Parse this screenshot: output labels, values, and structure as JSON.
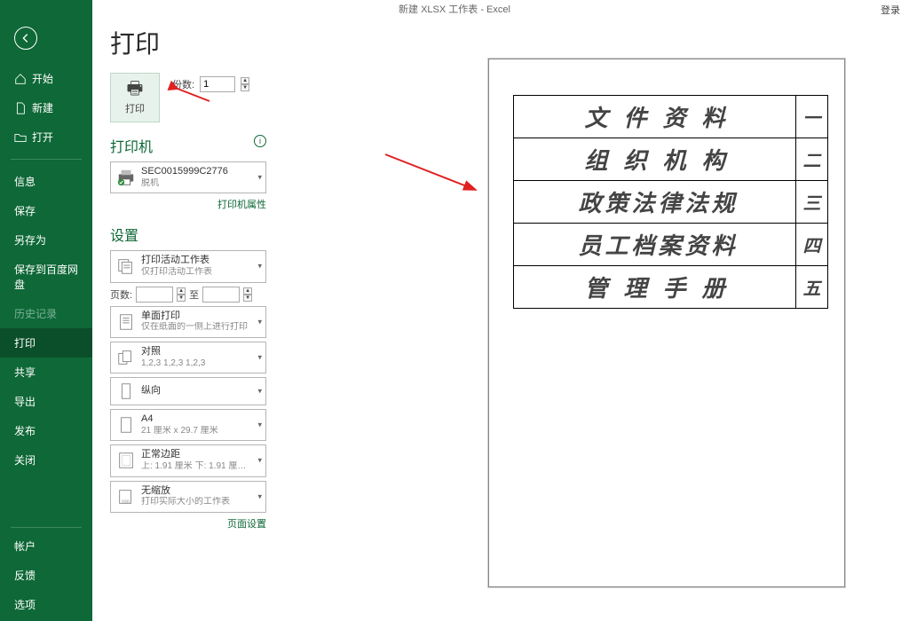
{
  "window": {
    "title": "新建 XLSX 工作表 - Excel",
    "login": "登录"
  },
  "sidebar": {
    "home": "开始",
    "new": "新建",
    "open": "打开",
    "info": "信息",
    "save": "保存",
    "saveas": "另存为",
    "savebaidu": "保存到百度网盘",
    "history": "历史记录",
    "print": "打印",
    "share": "共享",
    "export": "导出",
    "publish": "发布",
    "close": "关闭",
    "account": "帐户",
    "feedback": "反馈",
    "options": "选项"
  },
  "panel": {
    "title": "打印",
    "print_btn": "打印",
    "copies_label": "份数:",
    "copies_value": "1",
    "printer_section": "打印机",
    "printer_name": "SEC0015999C2776",
    "printer_status": "脱机",
    "printer_props": "打印机属性",
    "settings_section": "设置",
    "scope_main": "打印活动工作表",
    "scope_sub": "仅打印活动工作表",
    "pages_label": "页数:",
    "pages_to": "至",
    "side_main": "单面打印",
    "side_sub": "仅在纸面的一侧上进行打印",
    "collate_main": "对照",
    "collate_sub": "1,2,3   1,2,3   1,2,3",
    "orient_main": "纵向",
    "paper_main": "A4",
    "paper_sub": "21 厘米 x 29.7 厘米",
    "margin_main": "正常边距",
    "margin_sub": "上: 1.91 厘米 下: 1.91 厘…",
    "scale_main": "无缩放",
    "scale_sub": "打印实际大小的工作表",
    "page_setup": "页面设置"
  },
  "sheet": {
    "rows": [
      {
        "text": "文件资料",
        "num": "一",
        "cls": "wide"
      },
      {
        "text": "组织机构",
        "num": "二",
        "cls": "wide"
      },
      {
        "text": "政策法律法规",
        "num": "三",
        "cls": "wide sm"
      },
      {
        "text": "员工档案资料",
        "num": "四",
        "cls": "wide sm"
      },
      {
        "text": "管理手册",
        "num": "五",
        "cls": "wide"
      }
    ]
  }
}
